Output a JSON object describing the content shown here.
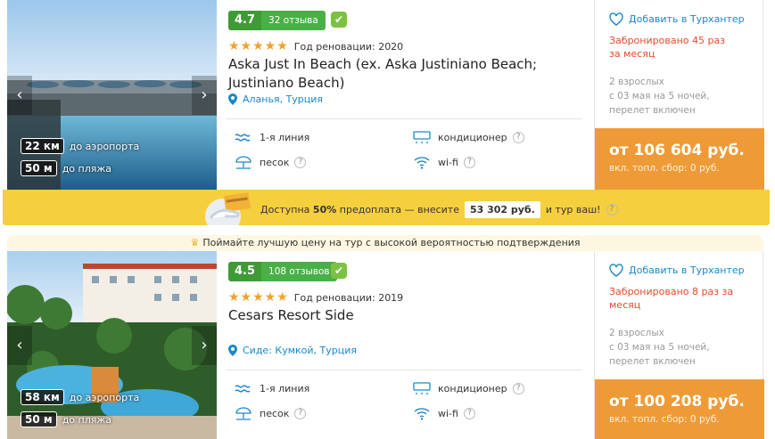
{
  "hotels": [
    {
      "rating_score": "4.7",
      "reviews": "32 отзыва",
      "stars": "★★★★★",
      "renovation": "Год реновации: 2020",
      "name": "Aska Just In Beach (ex. Aska Justiniano Beach; Justiniano Beach)",
      "location": "Аланья, Турция",
      "airport_km": "22 км",
      "airport_label": "до аэропорта",
      "beach_m": "50 м",
      "beach_label": "до пляжа",
      "features": {
        "line": "1-я линия",
        "ac": "кондиционер",
        "beach": "песок",
        "wifi": "wi-fi"
      },
      "favorite": "Добавить в Турхантер",
      "booked": "Забронировано 45 раз за месяц",
      "tour_lines": [
        "2 взрослых",
        "с 03 мая на 5 ночей,",
        "перелет включен"
      ],
      "price": "от 106 604 руб.",
      "fee": "вкл. топл. сбор: 0 руб."
    },
    {
      "rating_score": "4.5",
      "reviews": "108 отзывов",
      "stars": "★★★★★",
      "renovation": "Год реновации: 2019",
      "name": "Cesars Resort Side",
      "location": "Сиде: Кумкой, Турция",
      "airport_km": "58 км",
      "airport_label": "до аэропорта",
      "beach_m": "50 м",
      "beach_label": "до пляжа",
      "features": {
        "line": "1-я линия",
        "ac": "кондиционер",
        "beach": "песок",
        "wifi": "wi-fi"
      },
      "favorite": "Добавить в Турхантер",
      "booked": "Забронировано 8 раз за месяц",
      "tour_lines": [
        "2 взрослых",
        "с 03 мая на 5 ночей,",
        "перелет включен"
      ],
      "price": "от 100 208 руб.",
      "fee": "вкл. топл. сбор: 0 руб."
    }
  ],
  "prepay": {
    "text_before": "Доступна",
    "percent": "50%",
    "text_mid": "предоплата — внесите",
    "amount": "53 302 руб.",
    "text_after": "и тур ваш!"
  },
  "banner": {
    "text": "Поймайте лучшую цену на тур с высокой вероятностью подтверждения"
  },
  "help_mark": "?",
  "colors": {
    "accent_blue": "#1b87c9",
    "price_orange": "#ee9b37",
    "rating_green": "#48b046",
    "prepay_yellow": "#f6cf3e",
    "booked_red": "#e8492b"
  }
}
